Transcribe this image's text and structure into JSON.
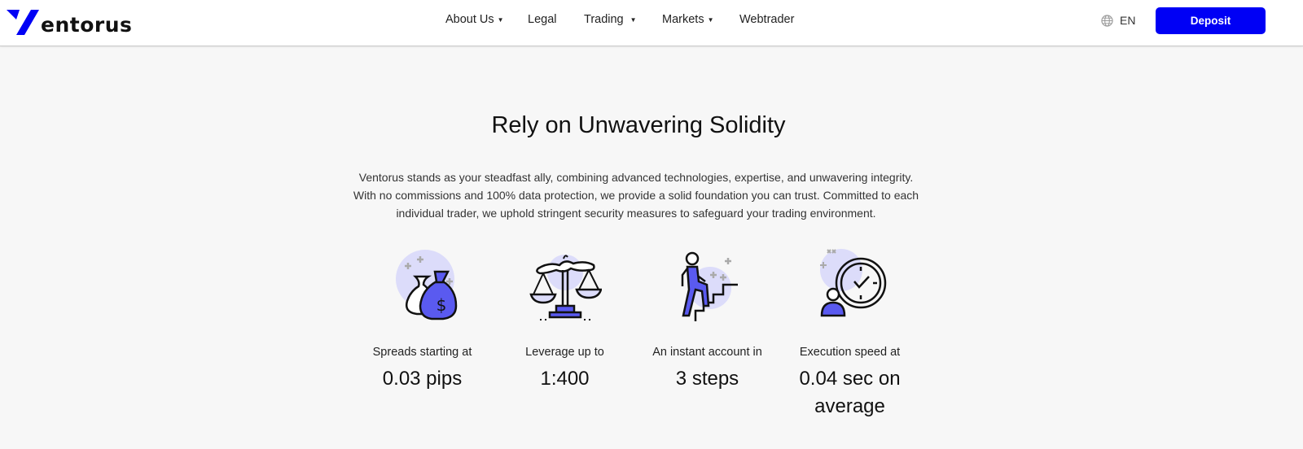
{
  "header": {
    "brand": "entorus",
    "brand_full": "Ventorus",
    "nav": [
      {
        "label": "About Us",
        "has_dropdown": true
      },
      {
        "label": "Legal",
        "has_dropdown": false
      },
      {
        "label": "Trading",
        "has_dropdown": true
      },
      {
        "label": "Markets",
        "has_dropdown": true
      },
      {
        "label": "Webtrader",
        "has_dropdown": false
      }
    ],
    "caret": "▼",
    "language": "EN",
    "deposit_label": "Deposit"
  },
  "main": {
    "title": "Rely on Unwavering Solidity",
    "description": "Ventorus stands as your steadfast ally, combining advanced technologies, expertise, and unwavering integrity. With no commissions and 100% data protection, we provide a solid foundation you can trust. Committed to each individual trader, we uphold stringent security measures to safeguard your trading environment.",
    "features": [
      {
        "icon": "money-bags-icon",
        "label": "Spreads starting at",
        "value": "0.03 pips"
      },
      {
        "icon": "scales-icon",
        "label": "Leverage up to",
        "value": "1:400"
      },
      {
        "icon": "stairs-climber-icon",
        "label": "An instant account in",
        "value": "3 steps"
      },
      {
        "icon": "clock-user-icon",
        "label": "Execution speed at",
        "value": "0.04 sec on average"
      }
    ]
  },
  "colors": {
    "brand_blue": "#0000f5",
    "icon_accent": "#5a5af0",
    "icon_circle": "#dcdcfa",
    "background": "#f7f7f7"
  }
}
